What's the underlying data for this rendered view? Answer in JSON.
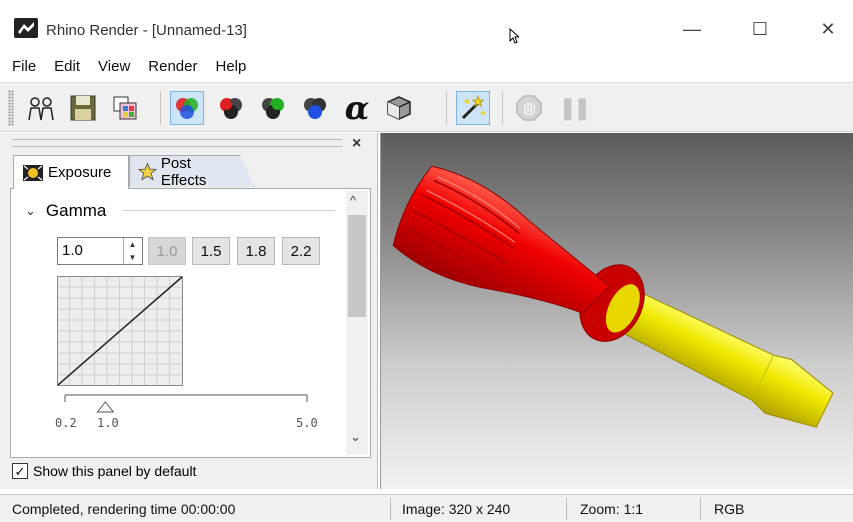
{
  "window": {
    "title": "Rhino Render - [Unnamed-13]",
    "minimize_glyph": "—",
    "maximize_glyph": "☐",
    "close_glyph": "✕"
  },
  "menu": [
    "File",
    "Edit",
    "View",
    "Render",
    "Help"
  ],
  "toolbar": {
    "icons": [
      "render-icon",
      "save-icon",
      "channels-icon",
      "rgb-channel-icon",
      "red-channel-icon",
      "green-channel-icon",
      "blue-channel-icon",
      "alpha-channel-icon",
      "monochrome-icon",
      "post-effects-icon",
      "stop-icon",
      "pause-icon"
    ],
    "alpha_glyph": "α",
    "pause_glyph": "❚❚"
  },
  "panel": {
    "close_glyph": "×",
    "tabs": [
      {
        "label": "Exposure",
        "active": true
      },
      {
        "label": "Post Effects",
        "active": false
      }
    ],
    "section_title": "Gamma",
    "chevron": "⌄",
    "gamma_value": "1.0",
    "presets": [
      "1.0",
      "1.5",
      "1.8",
      "2.2"
    ],
    "disabled_preset": "1.0",
    "slider": {
      "min_label": "0.2",
      "current_label": "1.0",
      "max_label": "5.0",
      "min": 0.2,
      "max": 5.0,
      "value": 1.0
    },
    "scroll_up": "^",
    "scroll_down": "⌄",
    "show_by_default_label": "Show this panel by default",
    "show_by_default_checked": true,
    "check_glyph": "✓"
  },
  "status": {
    "message": "Completed, rendering time 00:00:00",
    "image": "Image: 320 x 240",
    "zoom": "Zoom: 1:1",
    "channel": "RGB"
  },
  "colors": {
    "handle_red": "#e00000",
    "shaft_yellow": "#e8e000",
    "tab_inactive": "#dfe6ef",
    "toolbar_active": "#cce4f7"
  }
}
